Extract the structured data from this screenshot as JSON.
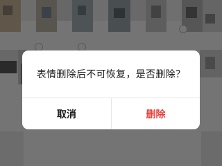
{
  "dialog": {
    "message": "表情删除后不可恢复，是否删除？",
    "cancel_label": "取消",
    "delete_label": "删除"
  },
  "colors": {
    "destructive": "#e64340",
    "overlay": "rgba(0,0,0,0.52)"
  }
}
